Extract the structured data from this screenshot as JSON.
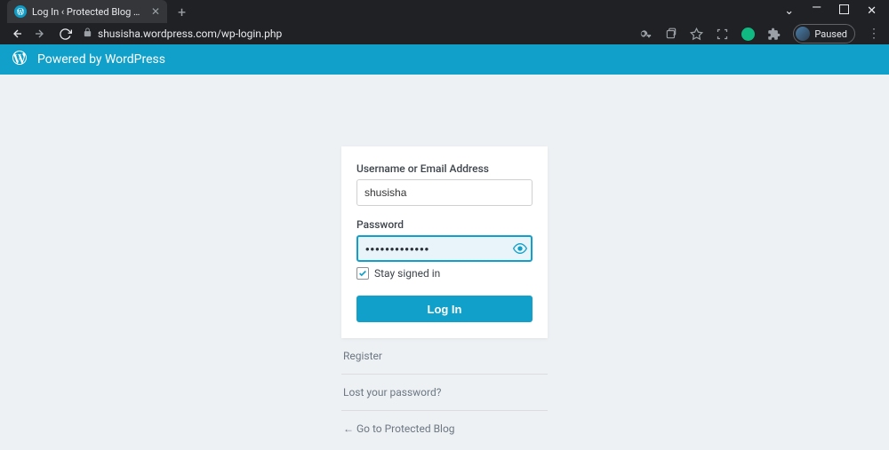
{
  "browser": {
    "tab_title": "Log In ‹ Protected Blog — WordP…",
    "url": "shusisha.wordpress.com/wp-login.php",
    "paused_label": "Paused"
  },
  "header": {
    "title": "Powered by WordPress"
  },
  "form": {
    "username_label": "Username or Email Address",
    "username_value": "shusisha",
    "password_label": "Password",
    "password_value": "•••••••••••••",
    "stay_signed_label": "Stay signed in",
    "stay_signed_checked": true,
    "login_button": "Log In"
  },
  "links": {
    "register": "Register",
    "lost_password": "Lost your password?",
    "back": "← Go to Protected Blog"
  }
}
